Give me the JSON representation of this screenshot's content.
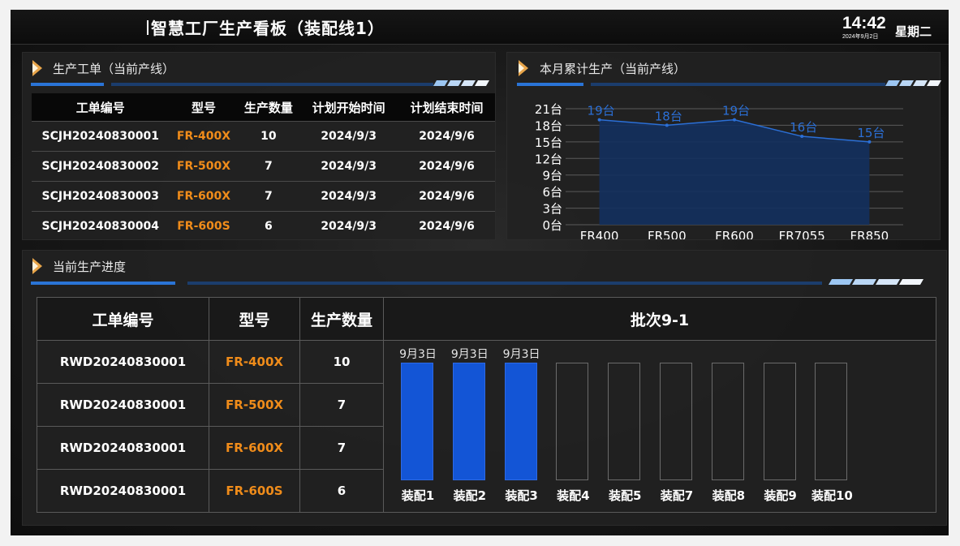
{
  "header": {
    "title": "智慧工厂生产看板（装配线1）",
    "time": "14:42",
    "date": "2024年9月2日",
    "weekday": "星期二"
  },
  "work_orders": {
    "title": "生产工单（当前产线）",
    "columns": [
      "工单编号",
      "型号",
      "生产数量",
      "计划开始时间",
      "计划结束时间"
    ],
    "rows": [
      {
        "id": "SCJH20240830001",
        "model": "FR-400X",
        "qty": "10",
        "start": "2024/9/3",
        "end": "2024/9/6"
      },
      {
        "id": "SCJH20240830002",
        "model": "FR-500X",
        "qty": "7",
        "start": "2024/9/3",
        "end": "2024/9/6"
      },
      {
        "id": "SCJH20240830003",
        "model": "FR-600X",
        "qty": "7",
        "start": "2024/9/3",
        "end": "2024/9/6"
      },
      {
        "id": "SCJH20240830004",
        "model": "FR-600S",
        "qty": "6",
        "start": "2024/9/3",
        "end": "2024/9/6"
      }
    ]
  },
  "monthly": {
    "title": "本月累计生产（当前产线）"
  },
  "chart_data": {
    "type": "area",
    "categories": [
      "FR400",
      "FR500",
      "FR600",
      "FR7055",
      "FR850"
    ],
    "values": [
      19,
      18,
      19,
      16,
      15
    ],
    "data_labels": [
      "19台",
      "18台",
      "19台",
      "16台",
      "15台"
    ],
    "yticks": [
      "0台",
      "3台",
      "6台",
      "9台",
      "12台",
      "15台",
      "18台",
      "21台"
    ],
    "ylim": [
      0,
      21
    ],
    "grid": true,
    "title": "",
    "xlabel": "",
    "ylabel": ""
  },
  "progress": {
    "title": "当前生产进度",
    "columns": [
      "工单编号",
      "型号",
      "生产数量"
    ],
    "batch_title": "批次9-1",
    "rows": [
      {
        "id": "RWD20240830001",
        "model": "FR-400X",
        "qty": "10"
      },
      {
        "id": "RWD20240830001",
        "model": "FR-500X",
        "qty": "7"
      },
      {
        "id": "RWD20240830001",
        "model": "FR-600X",
        "qty": "7"
      },
      {
        "id": "RWD20240830001",
        "model": "FR-600S",
        "qty": "6"
      }
    ],
    "stations": [
      {
        "name": "装配1",
        "date": "9月3日",
        "done": true
      },
      {
        "name": "装配2",
        "date": "9月3日",
        "done": true
      },
      {
        "name": "装配3",
        "date": "9月3日",
        "done": true
      },
      {
        "name": "装配4",
        "date": "",
        "done": false
      },
      {
        "name": "装配5",
        "date": "",
        "done": false
      },
      {
        "name": "装配7",
        "date": "",
        "done": false
      },
      {
        "name": "装配8",
        "date": "",
        "done": false
      },
      {
        "name": "装配9",
        "date": "",
        "done": false
      },
      {
        "name": "装配10",
        "date": "",
        "done": false
      }
    ]
  },
  "colors": {
    "accent_blue": "#2a74d6",
    "station_done": "#1355d6",
    "model_orange": "#f08c1a",
    "chart_line": "#2b6fd6",
    "chart_fill": "#13305e",
    "arrow_orange": "#e8a54a"
  },
  "icons": {
    "panel_marker": "chevron-right-icon"
  }
}
